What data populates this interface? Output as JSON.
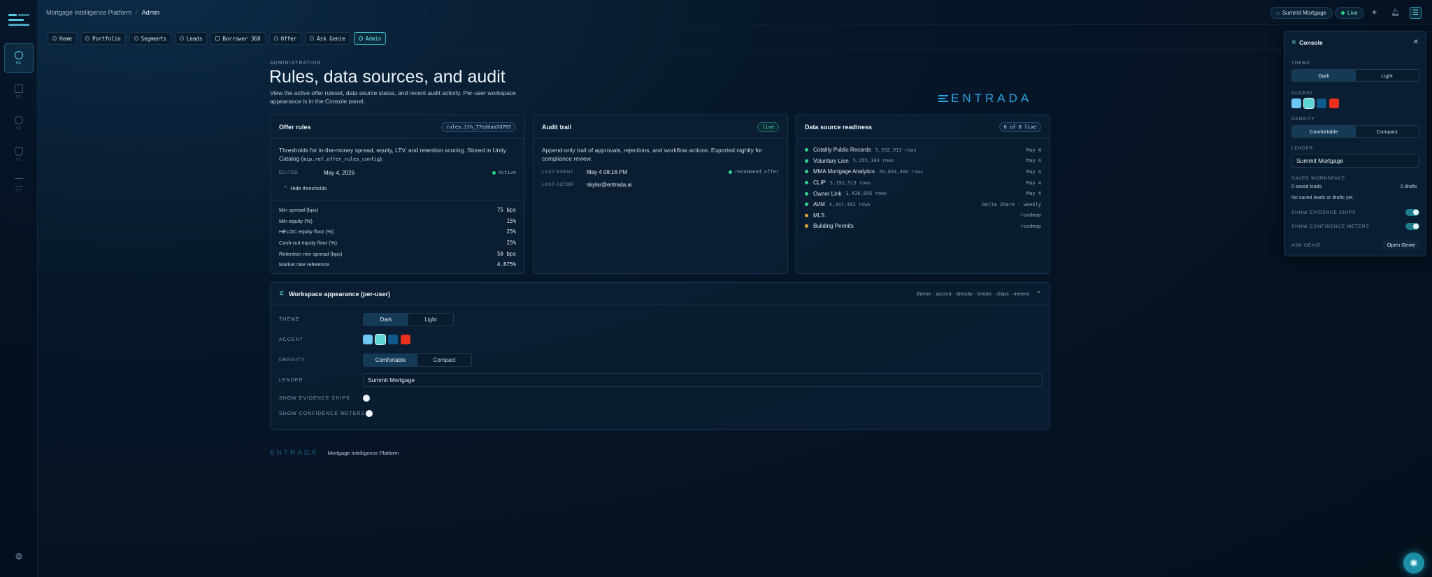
{
  "topbar": {
    "app_name": "Mortgage Intelligence Platform",
    "current": "Admin",
    "lender_pill": "Summit Mortgage",
    "live_pill": "Live"
  },
  "rail": {
    "items": [
      {
        "label": "HE"
      },
      {
        "label": "SO"
      },
      {
        "label": "SE"
      },
      {
        "label": "SC"
      },
      {
        "label": "SH"
      }
    ]
  },
  "nav": {
    "tabs": [
      "Home",
      "Portfolio",
      "Segments",
      "Leads",
      "Borrower 360",
      "Offer",
      "Ask Genie",
      "Admin"
    ]
  },
  "header": {
    "eyebrow": "ADMINISTRATION",
    "title": "Rules, data sources, and audit",
    "description": "View the active offer ruleset, data source status, and recent audit activity. Per-user workspace appearance is in the Console panel.",
    "brand": "ENTRADA"
  },
  "offer_rules": {
    "title": "Offer rules",
    "chip": "rules.1th_77eddaa7d767",
    "description_pre": "Thresholds for in-the-money spread, equity, LTV, and retention scoring. Stored in Unity Catalog (",
    "description_code": "mip.ref.offer_rules_config",
    "description_post": ").",
    "edited_label": "EDITED",
    "edited_value": "May 4, 2026",
    "status": "Active",
    "hide_label": "Hide thresholds",
    "thresholds": [
      {
        "name": "Min spread (bps)",
        "value": "75 bps"
      },
      {
        "name": "Min equity (%)",
        "value": "15%"
      },
      {
        "name": "HELOC equity floor (%)",
        "value": "25%"
      },
      {
        "name": "Cash-out equity floor (%)",
        "value": "25%"
      },
      {
        "name": "Retention min spread (bps)",
        "value": "50 bps"
      },
      {
        "name": "Market rate reference",
        "value": "4.875%"
      }
    ]
  },
  "audit": {
    "title": "Audit trail",
    "chip": "live",
    "description": "Append-only trail of approvals, rejections, and workflow actions. Exported nightly for compliance review.",
    "last_event_label": "LAST EVENT",
    "last_event_value": "May 4 08:16 PM",
    "last_event_action": "recommend_offer",
    "last_actor_label": "LAST ACTOR",
    "last_actor_value": "skylar@entrada.ai"
  },
  "datasources": {
    "title": "Data source readiness",
    "chip": "6 of 8 live",
    "rows": [
      {
        "name": "Cotality Public Records",
        "rows": "5,592,913 rows",
        "when": "May 4",
        "status": "live"
      },
      {
        "name": "Voluntary Lien",
        "rows": "5,155,184 rows",
        "when": "May 4",
        "status": "live"
      },
      {
        "name": "MMA Mortgage Analytics",
        "rows": "26,834,460 rows",
        "when": "May 4",
        "status": "live"
      },
      {
        "name": "CLIP",
        "rows": "5,192,513 rows",
        "when": "May 4",
        "status": "live"
      },
      {
        "name": "Owner Link",
        "rows": "3,436,856 rows",
        "when": "May 4",
        "status": "live"
      },
      {
        "name": "AVM",
        "rows": "4,347,492 rows",
        "when": "Delta Share · weekly",
        "status": "live"
      },
      {
        "name": "MLS",
        "rows": "",
        "when": "roadmap",
        "status": "roadmap"
      },
      {
        "name": "Building Permits",
        "rows": "",
        "when": "roadmap",
        "status": "roadmap"
      }
    ]
  },
  "appearance": {
    "title": "Workspace appearance (per-user)",
    "meta": "theme · accent · density · lender · chips · meters",
    "theme_label": "THEME",
    "theme_options": [
      "Dark",
      "Light"
    ],
    "accent_label": "ACCENT",
    "density_label": "DENSITY",
    "density_options": [
      "Comfortable",
      "Compact"
    ],
    "lender_label": "LENDER",
    "lender_value": "Summit Mortgage",
    "chips_label": "SHOW EVIDENCE CHIPS",
    "meters_label": "SHOW CONFIDENCE METERS"
  },
  "footer": {
    "brand": "ENTRADA",
    "text": "Mortgage Intelligence Platform"
  },
  "console": {
    "title": "Console",
    "theme_label": "THEME",
    "theme_options": [
      "Dark",
      "Light"
    ],
    "accent_label": "ACCENT",
    "density_label": "DENSITY",
    "density_options": [
      "Comfortable",
      "Compact"
    ],
    "lender_label": "LENDER",
    "lender_value": "Summit Mortgage",
    "saved_label": "SAVED WORKSPACE",
    "saved_leads": "0 saved leads",
    "saved_drafts": "0 drafts",
    "saved_empty": "No saved leads or drafts yet.",
    "chips_label": "SHOW EVIDENCE CHIPS",
    "meters_label": "SHOW CONFIDENCE METERS",
    "genie_label": "ASK GENIE",
    "genie_button": "Open Genie"
  },
  "colors": {
    "accent_swatches": [
      "#6cc6f2",
      "#5fd6d6",
      "#0f5a8c",
      "#e8321e"
    ],
    "live": "#2fd48a",
    "roadmap": "#e6a23c",
    "brand": "#2aa3e0"
  }
}
